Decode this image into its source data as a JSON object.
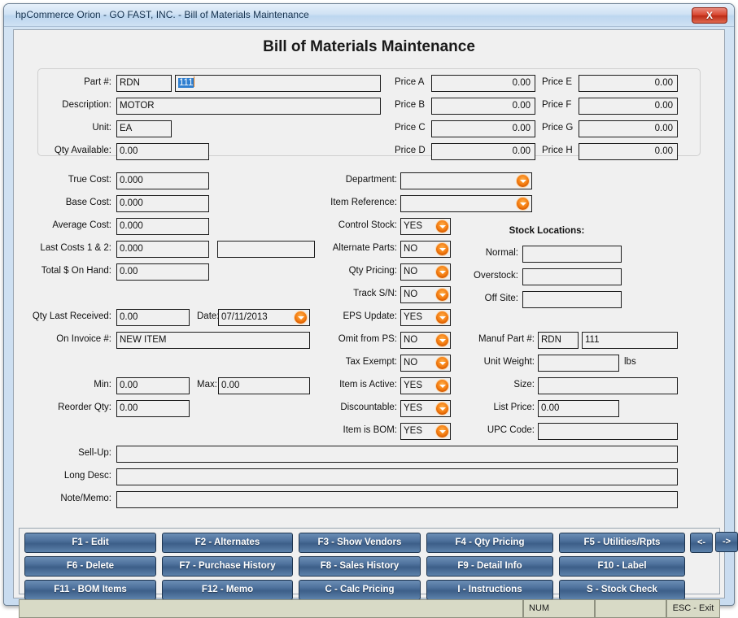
{
  "window": {
    "title": "hpCommerce Orion - GO FAST, INC. - Bill of Materials Maintenance",
    "close_label": "X"
  },
  "page": {
    "title": "Bill of Materials Maintenance"
  },
  "header_panel": {
    "part_label": "Part #:",
    "part_prefix": "RDN",
    "part_number": "111",
    "description_label": "Description:",
    "description": "MOTOR",
    "unit_label": "Unit:",
    "unit": "EA",
    "qty_available_label": "Qty Available:",
    "qty_available": "0.00",
    "prices": [
      {
        "label": "Price A",
        "value": "0.00"
      },
      {
        "label": "Price B",
        "value": "0.00"
      },
      {
        "label": "Price C",
        "value": "0.00"
      },
      {
        "label": "Price D",
        "value": "0.00"
      },
      {
        "label": "Price E",
        "value": "0.00"
      },
      {
        "label": "Price F",
        "value": "0.00"
      },
      {
        "label": "Price G",
        "value": "0.00"
      },
      {
        "label": "Price H",
        "value": "0.00"
      }
    ]
  },
  "costs": {
    "true_cost_label": "True Cost:",
    "true_cost": "0.000",
    "base_cost_label": "Base Cost:",
    "base_cost": "0.000",
    "average_cost_label": "Average Cost:",
    "average_cost": "0.000",
    "last_costs_label": "Last Costs 1 & 2:",
    "last_cost_1": "0.000",
    "last_cost_2": "",
    "total_on_hand_label": "Total $ On Hand:",
    "total_on_hand": "0.00"
  },
  "receiving": {
    "qty_last_received_label": "Qty Last Received:",
    "qty_last_received": "0.00",
    "date_label": "Date:",
    "date": "07/11/2013",
    "on_invoice_label": "On Invoice #:",
    "on_invoice": "NEW ITEM",
    "min_label": "Min:",
    "min": "0.00",
    "max_label": "Max:",
    "max": "0.00",
    "reorder_qty_label": "Reorder Qty:",
    "reorder_qty": "0.00"
  },
  "options": {
    "department_label": "Department:",
    "department": "",
    "item_reference_label": "Item Reference:",
    "item_reference": "",
    "flags": [
      {
        "label": "Control Stock:",
        "value": "YES"
      },
      {
        "label": "Alternate Parts:",
        "value": "NO"
      },
      {
        "label": "Qty Pricing:",
        "value": "NO"
      },
      {
        "label": "Track S/N:",
        "value": "NO"
      },
      {
        "label": "EPS Update:",
        "value": "YES"
      },
      {
        "label": "Omit from PS:",
        "value": "NO"
      },
      {
        "label": "Tax Exempt:",
        "value": "NO"
      },
      {
        "label": "Item is Active:",
        "value": "YES"
      },
      {
        "label": "Discountable:",
        "value": "YES"
      },
      {
        "label": "Item is BOM:",
        "value": "YES"
      }
    ]
  },
  "stock_locations": {
    "heading": "Stock Locations:",
    "normal_label": "Normal:",
    "normal": "",
    "overstock_label": "Overstock:",
    "overstock": "",
    "off_site_label": "Off Site:",
    "off_site": ""
  },
  "manufacturer": {
    "manuf_part_label": "Manuf Part #:",
    "manuf_part_prefix": "RDN",
    "manuf_part_number": "111",
    "unit_weight_label": "Unit Weight:",
    "unit_weight": "",
    "unit_weight_units": "lbs",
    "size_label": "Size:",
    "size": "",
    "list_price_label": "List Price:",
    "list_price": "0.00",
    "upc_code_label": "UPC Code:",
    "upc_code": ""
  },
  "notes": {
    "sell_up_label": "Sell-Up:",
    "sell_up": "",
    "long_desc_label": "Long Desc:",
    "long_desc": "",
    "note_memo_label": "Note/Memo:",
    "note_memo": ""
  },
  "buttons": [
    {
      "label": "F1 - Edit"
    },
    {
      "label": "F2 - Alternates"
    },
    {
      "label": "F3 - Show Vendors"
    },
    {
      "label": "F4 - Qty Pricing"
    },
    {
      "label": "F5 - Utilities/Rpts"
    },
    {
      "label": "F6 - Delete"
    },
    {
      "label": "F7 - Purchase History"
    },
    {
      "label": "F8 - Sales History"
    },
    {
      "label": "F9 - Detail Info"
    },
    {
      "label": "F10 - Label"
    },
    {
      "label": "F11 - BOM Items"
    },
    {
      "label": "F12 - Memo"
    },
    {
      "label": "C - Calc Pricing"
    },
    {
      "label": "I - Instructions"
    },
    {
      "label": "S - Stock Check"
    }
  ],
  "nav": {
    "prev_label": "<-",
    "next_label": "->"
  },
  "statusbar": {
    "message": "",
    "num_indicator": "NUM",
    "spare": "",
    "exit_hint": "ESC - Exit"
  }
}
